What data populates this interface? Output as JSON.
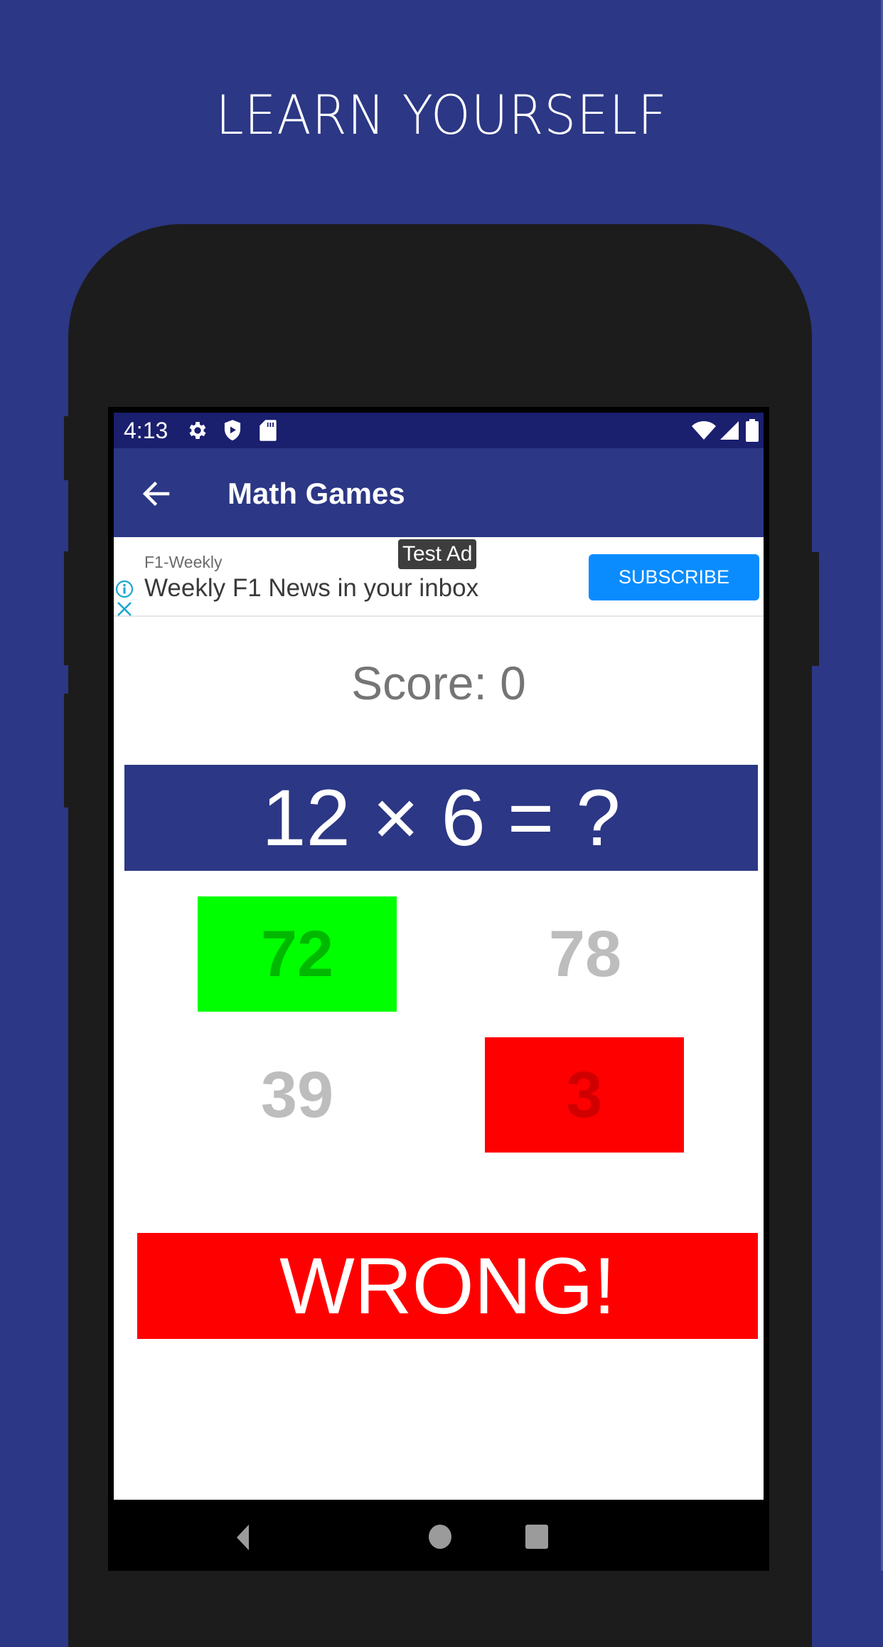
{
  "promo": {
    "title": "LEARN YOURSELF"
  },
  "colors": {
    "background": "#2c3785",
    "status_bar": "#1a1f6e",
    "app_bar": "#2c3785",
    "correct": "#00ff00",
    "wrong": "#ff0000",
    "ad_cta": "#0a8cff"
  },
  "status_bar": {
    "time": "4:13",
    "left_icons": [
      "gear-icon",
      "shield-play-icon",
      "sd-card-icon"
    ],
    "right_icons": [
      "wifi-icon",
      "signal-icon",
      "battery-icon"
    ]
  },
  "app_bar": {
    "back_icon": "arrow-left-icon",
    "title": "Math Games"
  },
  "ad": {
    "badge": "Test Ad",
    "advertiser": "F1-Weekly",
    "headline": "Weekly F1 News in your inbox",
    "cta": "SUBSCRIBE",
    "info_icon": "info-icon",
    "close_icon": "close-icon"
  },
  "game": {
    "score_label": "Score: 0",
    "question": "12 × 6 = ?",
    "answers": [
      {
        "value": "72",
        "state": "correct"
      },
      {
        "value": "78",
        "state": "neutral"
      },
      {
        "value": "39",
        "state": "neutral"
      },
      {
        "value": "3",
        "state": "wrong"
      }
    ],
    "result": "WRONG!"
  },
  "nav_bar": {
    "buttons": [
      "back-triangle-icon",
      "home-circle-icon",
      "recents-square-icon"
    ]
  }
}
